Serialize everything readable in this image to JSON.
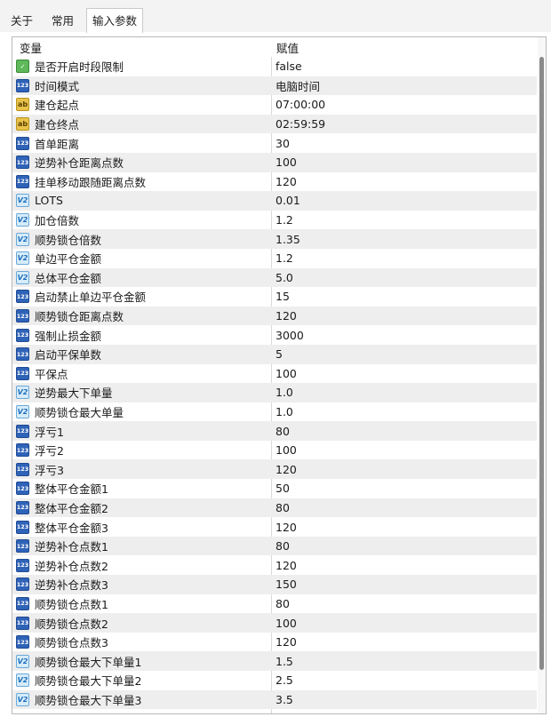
{
  "tabs": [
    {
      "label": "关于"
    },
    {
      "label": "常用"
    },
    {
      "label": "输入参数"
    }
  ],
  "active_tab": "输入参数",
  "table": {
    "headers": {
      "name": "变量",
      "value": "赋值"
    },
    "rows": [
      {
        "icon": "bool-icon",
        "name": "是否开启时段限制",
        "value": "false"
      },
      {
        "icon": "int-icon",
        "name": "时间模式",
        "value": "电脑时间"
      },
      {
        "icon": "string-icon",
        "name": "建仓起点",
        "value": "07:00:00"
      },
      {
        "icon": "string-icon",
        "name": "建仓终点",
        "value": "02:59:59"
      },
      {
        "icon": "int-icon",
        "name": "首单距离",
        "value": "30"
      },
      {
        "icon": "int-icon",
        "name": "逆势补仓距离点数",
        "value": "100"
      },
      {
        "icon": "int-icon",
        "name": "挂单移动跟随距离点数",
        "value": "120"
      },
      {
        "icon": "double-icon",
        "name": "LOTS",
        "value": "0.01"
      },
      {
        "icon": "double-icon",
        "name": "加仓倍数",
        "value": "1.2"
      },
      {
        "icon": "double-icon",
        "name": "顺势锁仓倍数",
        "value": "1.35"
      },
      {
        "icon": "double-icon",
        "name": "单边平仓金额",
        "value": "1.2"
      },
      {
        "icon": "double-icon",
        "name": "总体平仓金额",
        "value": "5.0"
      },
      {
        "icon": "int-icon",
        "name": "启动禁止单边平仓金额",
        "value": "15"
      },
      {
        "icon": "int-icon",
        "name": "顺势锁仓距离点数",
        "value": "120"
      },
      {
        "icon": "int-icon",
        "name": "强制止损金额",
        "value": "3000"
      },
      {
        "icon": "int-icon",
        "name": "启动平保单数",
        "value": "5"
      },
      {
        "icon": "int-icon",
        "name": "平保点",
        "value": "100"
      },
      {
        "icon": "double-icon",
        "name": "逆势最大下单量",
        "value": "1.0"
      },
      {
        "icon": "double-icon",
        "name": "顺势锁仓最大单量",
        "value": "1.0"
      },
      {
        "icon": "int-icon",
        "name": "浮亏1",
        "value": "80"
      },
      {
        "icon": "int-icon",
        "name": "浮亏2",
        "value": "100"
      },
      {
        "icon": "int-icon",
        "name": "浮亏3",
        "value": "120"
      },
      {
        "icon": "int-icon",
        "name": "整体平仓金额1",
        "value": "50"
      },
      {
        "icon": "int-icon",
        "name": "整体平仓金额2",
        "value": "80"
      },
      {
        "icon": "int-icon",
        "name": "整体平仓金额3",
        "value": "120"
      },
      {
        "icon": "int-icon",
        "name": "逆势补仓点数1",
        "value": "80"
      },
      {
        "icon": "int-icon",
        "name": "逆势补仓点数2",
        "value": "120"
      },
      {
        "icon": "int-icon",
        "name": "逆势补仓点数3",
        "value": "150"
      },
      {
        "icon": "int-icon",
        "name": "顺势锁仓点数1",
        "value": "80"
      },
      {
        "icon": "int-icon",
        "name": "顺势锁仓点数2",
        "value": "100"
      },
      {
        "icon": "int-icon",
        "name": "顺势锁仓点数3",
        "value": "120"
      },
      {
        "icon": "double-icon",
        "name": "顺势锁仓最大下单量1",
        "value": "1.5"
      },
      {
        "icon": "double-icon",
        "name": "顺势锁仓最大下单量2",
        "value": "2.5"
      },
      {
        "icon": "double-icon",
        "name": "顺势锁仓最大下单量3",
        "value": "3.5"
      }
    ]
  },
  "icon_glyphs": {
    "int-icon": "123",
    "double-icon": "V2",
    "string-icon": "ab",
    "bool-icon": "✓"
  },
  "colors": {
    "row_alt": "#eeeeee",
    "int_icon": "#2f63b8",
    "double_icon": "#d6ecfa",
    "string_icon": "#e8c24a",
    "bool_icon": "#5fb85a"
  }
}
